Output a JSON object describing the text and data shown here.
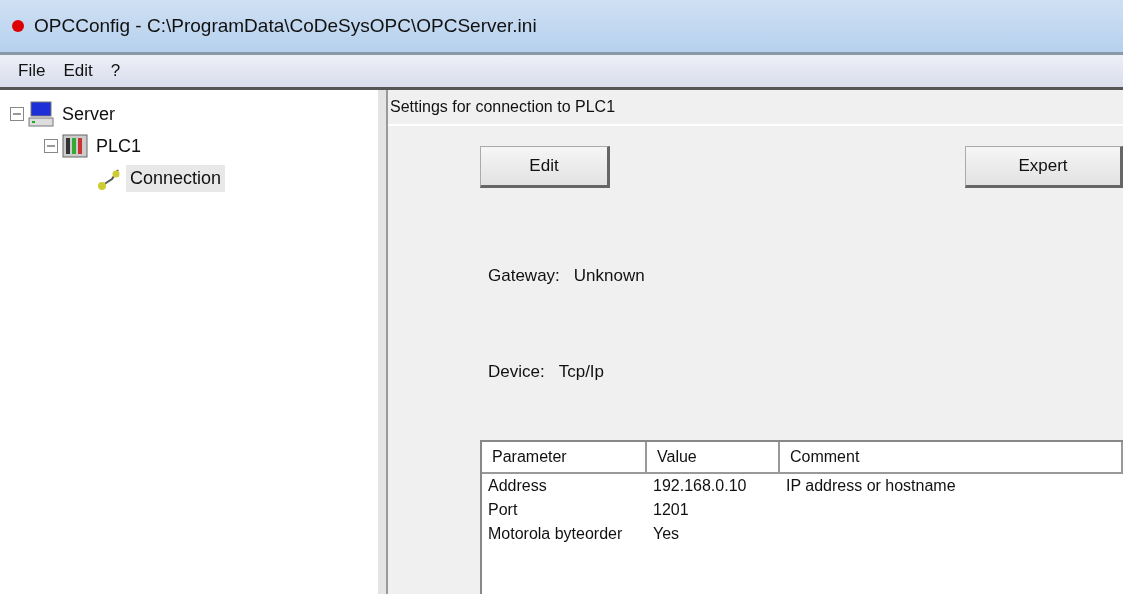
{
  "window": {
    "title": "OPCConfig - C:\\ProgramData\\CoDeSysOPC\\OPCServer.ini"
  },
  "menu": [
    "File",
    "Edit",
    "?"
  ],
  "tree": [
    {
      "label": "Server",
      "kind": "server",
      "expanded": true,
      "selected": false,
      "children": [
        {
          "label": "PLC1",
          "kind": "plc",
          "expanded": true,
          "selected": false,
          "children": [
            {
              "label": "Connection",
              "kind": "connection",
              "selected": true
            }
          ]
        }
      ]
    }
  ],
  "panel": {
    "title": "Settings for connection to PLC1",
    "buttons": [
      {
        "label": "Edit"
      },
      {
        "label": "Expert"
      }
    ],
    "fields": [
      {
        "label": "Gateway:",
        "value": "Unknown"
      },
      {
        "label": "Device:",
        "value": "Tcp/Ip"
      }
    ],
    "table": {
      "columns": [
        "Parameter",
        "Value",
        "Comment"
      ],
      "rows": [
        [
          "Address",
          "192.168.0.10",
          "IP address or hostname"
        ],
        [
          "Port",
          "1201",
          ""
        ],
        [
          "Motorola byteorder",
          "Yes",
          ""
        ]
      ]
    }
  }
}
